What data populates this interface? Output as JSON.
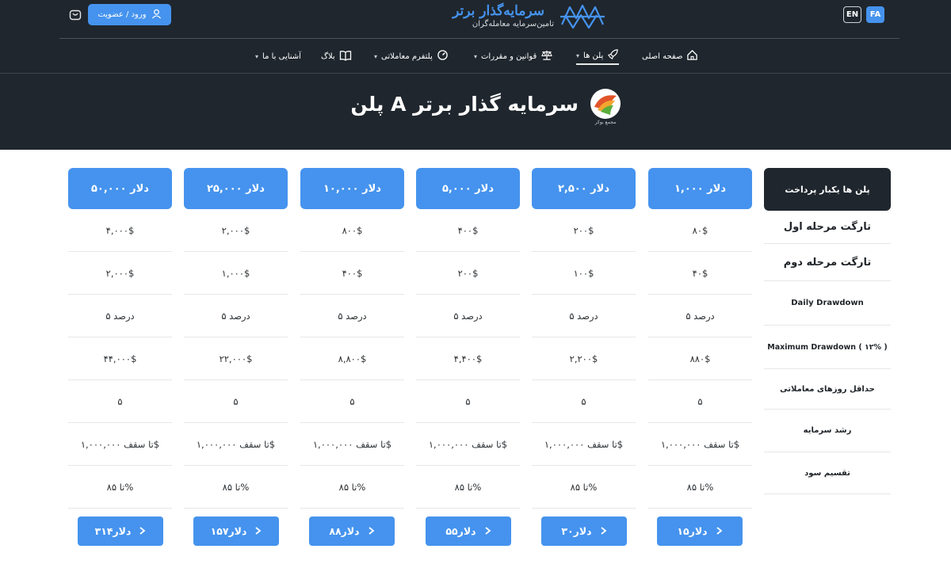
{
  "header": {
    "lang_en": "EN",
    "lang_fa": "FA",
    "logo_text": "سرمایه‌گذار برتر",
    "logo_subtitle": "تامین‌سرمایه معامله‌گران",
    "login_label": "ورود / عضویت"
  },
  "nav": {
    "home": "صفحه اصلی",
    "plans": "پلن ها",
    "rules": "قوانین و مقررات",
    "platform": "پلتفرم معاملاتی",
    "blog": "بلاگ",
    "about": "آشنایی با ما"
  },
  "hero": {
    "title": "پلن A سرمایه گذار برتر",
    "logo_caption": "مجمع بوکر"
  },
  "table": {
    "label_header": "پلن ها یکبار پرداخت",
    "row_labels": [
      "تارگت مرحله اول",
      "تارگت مرحله دوم",
      "Daily Drawdown",
      "Maximum Drawdown ( ۱۲% )",
      "حداقل روزهای معاملاتی",
      "رشد سرمایه",
      "تقسیم سود"
    ],
    "plans": [
      {
        "header": "۱,۰۰۰ دلار",
        "cells": [
          "۸۰$",
          "۴۰$",
          "۵ درصد",
          "۸۸۰$",
          "۵",
          "تا سقف ۱,۰۰۰,۰۰۰$",
          "تا ۸۵%"
        ],
        "price": "۱۵دلار"
      },
      {
        "header": "۲,۵۰۰ دلار",
        "cells": [
          "۲۰۰$",
          "۱۰۰$",
          "۵ درصد",
          "۲,۲۰۰$",
          "۵",
          "تا سقف ۱,۰۰۰,۰۰۰$",
          "تا ۸۵%"
        ],
        "price": "۳۰دلار"
      },
      {
        "header": "۵,۰۰۰ دلار",
        "cells": [
          "۴۰۰$",
          "۲۰۰$",
          "۵ درصد",
          "۴,۴۰۰$",
          "۵",
          "تا سقف ۱,۰۰۰,۰۰۰$",
          "تا ۸۵%"
        ],
        "price": "۵۵دلار"
      },
      {
        "header": "۱۰,۰۰۰ دلار",
        "cells": [
          "۸۰۰$",
          "۴۰۰$",
          "۵ درصد",
          "۸,۸۰۰$",
          "۵",
          "تا سقف ۱,۰۰۰,۰۰۰$",
          "تا ۸۵%"
        ],
        "price": "۸۸دلار"
      },
      {
        "header": "۲۵,۰۰۰ دلار",
        "cells": [
          "۲,۰۰۰$",
          "۱,۰۰۰$",
          "۵ درصد",
          "۲۲,۰۰۰$",
          "۵",
          "تا سقف ۱,۰۰۰,۰۰۰$",
          "تا ۸۵%"
        ],
        "price": "۱۵۷دلار"
      },
      {
        "header": "۵۰,۰۰۰ دلار",
        "cells": [
          "۴,۰۰۰$",
          "۲,۰۰۰$",
          "۵ درصد",
          "۴۴,۰۰۰$",
          "۵",
          "تا سقف ۱,۰۰۰,۰۰۰$",
          "تا ۸۵%"
        ],
        "price": "۳۱۴دلار"
      }
    ]
  },
  "colors": {
    "header_bg": "#1f262d",
    "accent_blue": "#4593ee",
    "divider": "#e4e7ea"
  },
  "icons": {
    "home": "home-icon",
    "plans": "rocket-icon",
    "rules": "scales-icon",
    "platform": "gauge-icon",
    "blog": "book-icon",
    "user": "user-icon",
    "cart": "cart-icon",
    "arrow": "chevron-right-icon"
  }
}
